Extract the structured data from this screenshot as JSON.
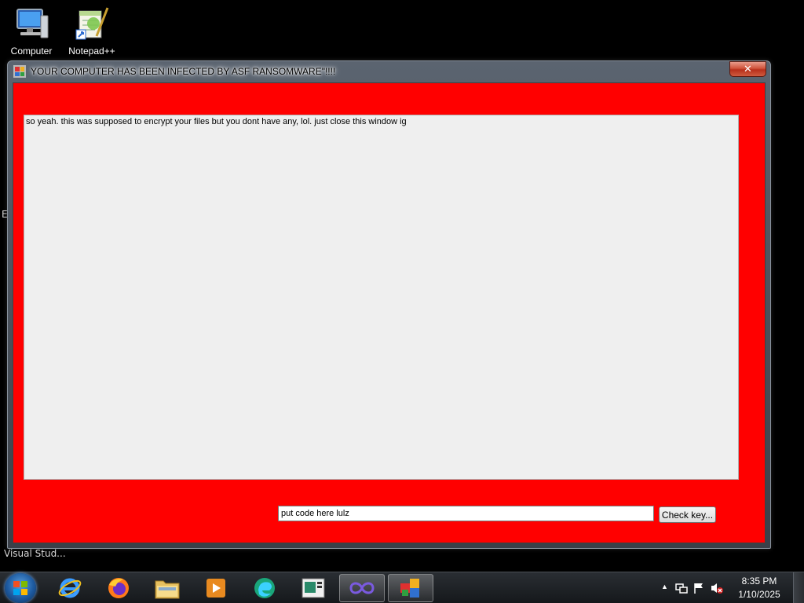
{
  "desktop": {
    "icons": [
      {
        "label": "Computer",
        "icon": "computer-icon"
      },
      {
        "label": "Notepad++",
        "icon": "notepadpp-icon"
      }
    ],
    "stray_left": "E",
    "stray_bottom": "Visual Stud..."
  },
  "window": {
    "title": "YOUR COMPUTER HAS BEEN INFECTED BY ASF RANSOMWARE\"!!!!",
    "close_label": "✕",
    "background_color": "#ff0000",
    "message": "so yeah. this was supposed to encrypt your files but you dont have any, lol. just close this window ig",
    "code_input": {
      "value": "put code here lulz"
    },
    "check_button_label": "Check key..."
  },
  "taskbar": {
    "pinned": [
      "internet-explorer-icon",
      "firefox-icon",
      "file-explorer-icon",
      "media-player-icon",
      "edge-icon",
      "app-window-icon",
      "visual-studio-icon",
      "ransomware-app-icon"
    ],
    "clock": {
      "time": "8:35 PM",
      "date": "1/10/2025"
    },
    "tray_arrow": "▲"
  }
}
